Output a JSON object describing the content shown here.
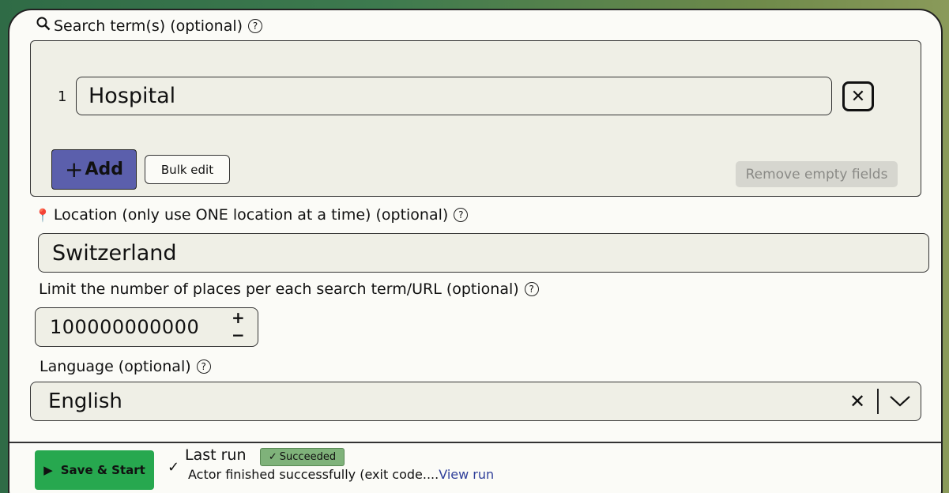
{
  "search": {
    "label": "Search term(s) (optional)",
    "terms": [
      {
        "index": "1",
        "value": "Hospital"
      }
    ],
    "add_label": "Add",
    "bulk_edit_label": "Bulk edit",
    "remove_empty_label": "Remove empty fields"
  },
  "location": {
    "label": "Location (only use ONE location at a time) (optional)",
    "value": "Switzerland"
  },
  "limit": {
    "label": "Limit the number of places per each search term/URL (optional)",
    "value": "100000000000"
  },
  "language": {
    "label": "Language (optional)",
    "value": "English"
  },
  "footer": {
    "save_label": "Save & Start",
    "last_run_label": "Last run",
    "status": "Succeeded",
    "message": "Actor finished successfully (exit code....",
    "view_run_label": "View run"
  },
  "colors": {
    "accent_purple": "#5b5fac",
    "save_green": "#27a84f",
    "status_green": "#7fb27a",
    "link_blue": "#2f3f9a"
  }
}
